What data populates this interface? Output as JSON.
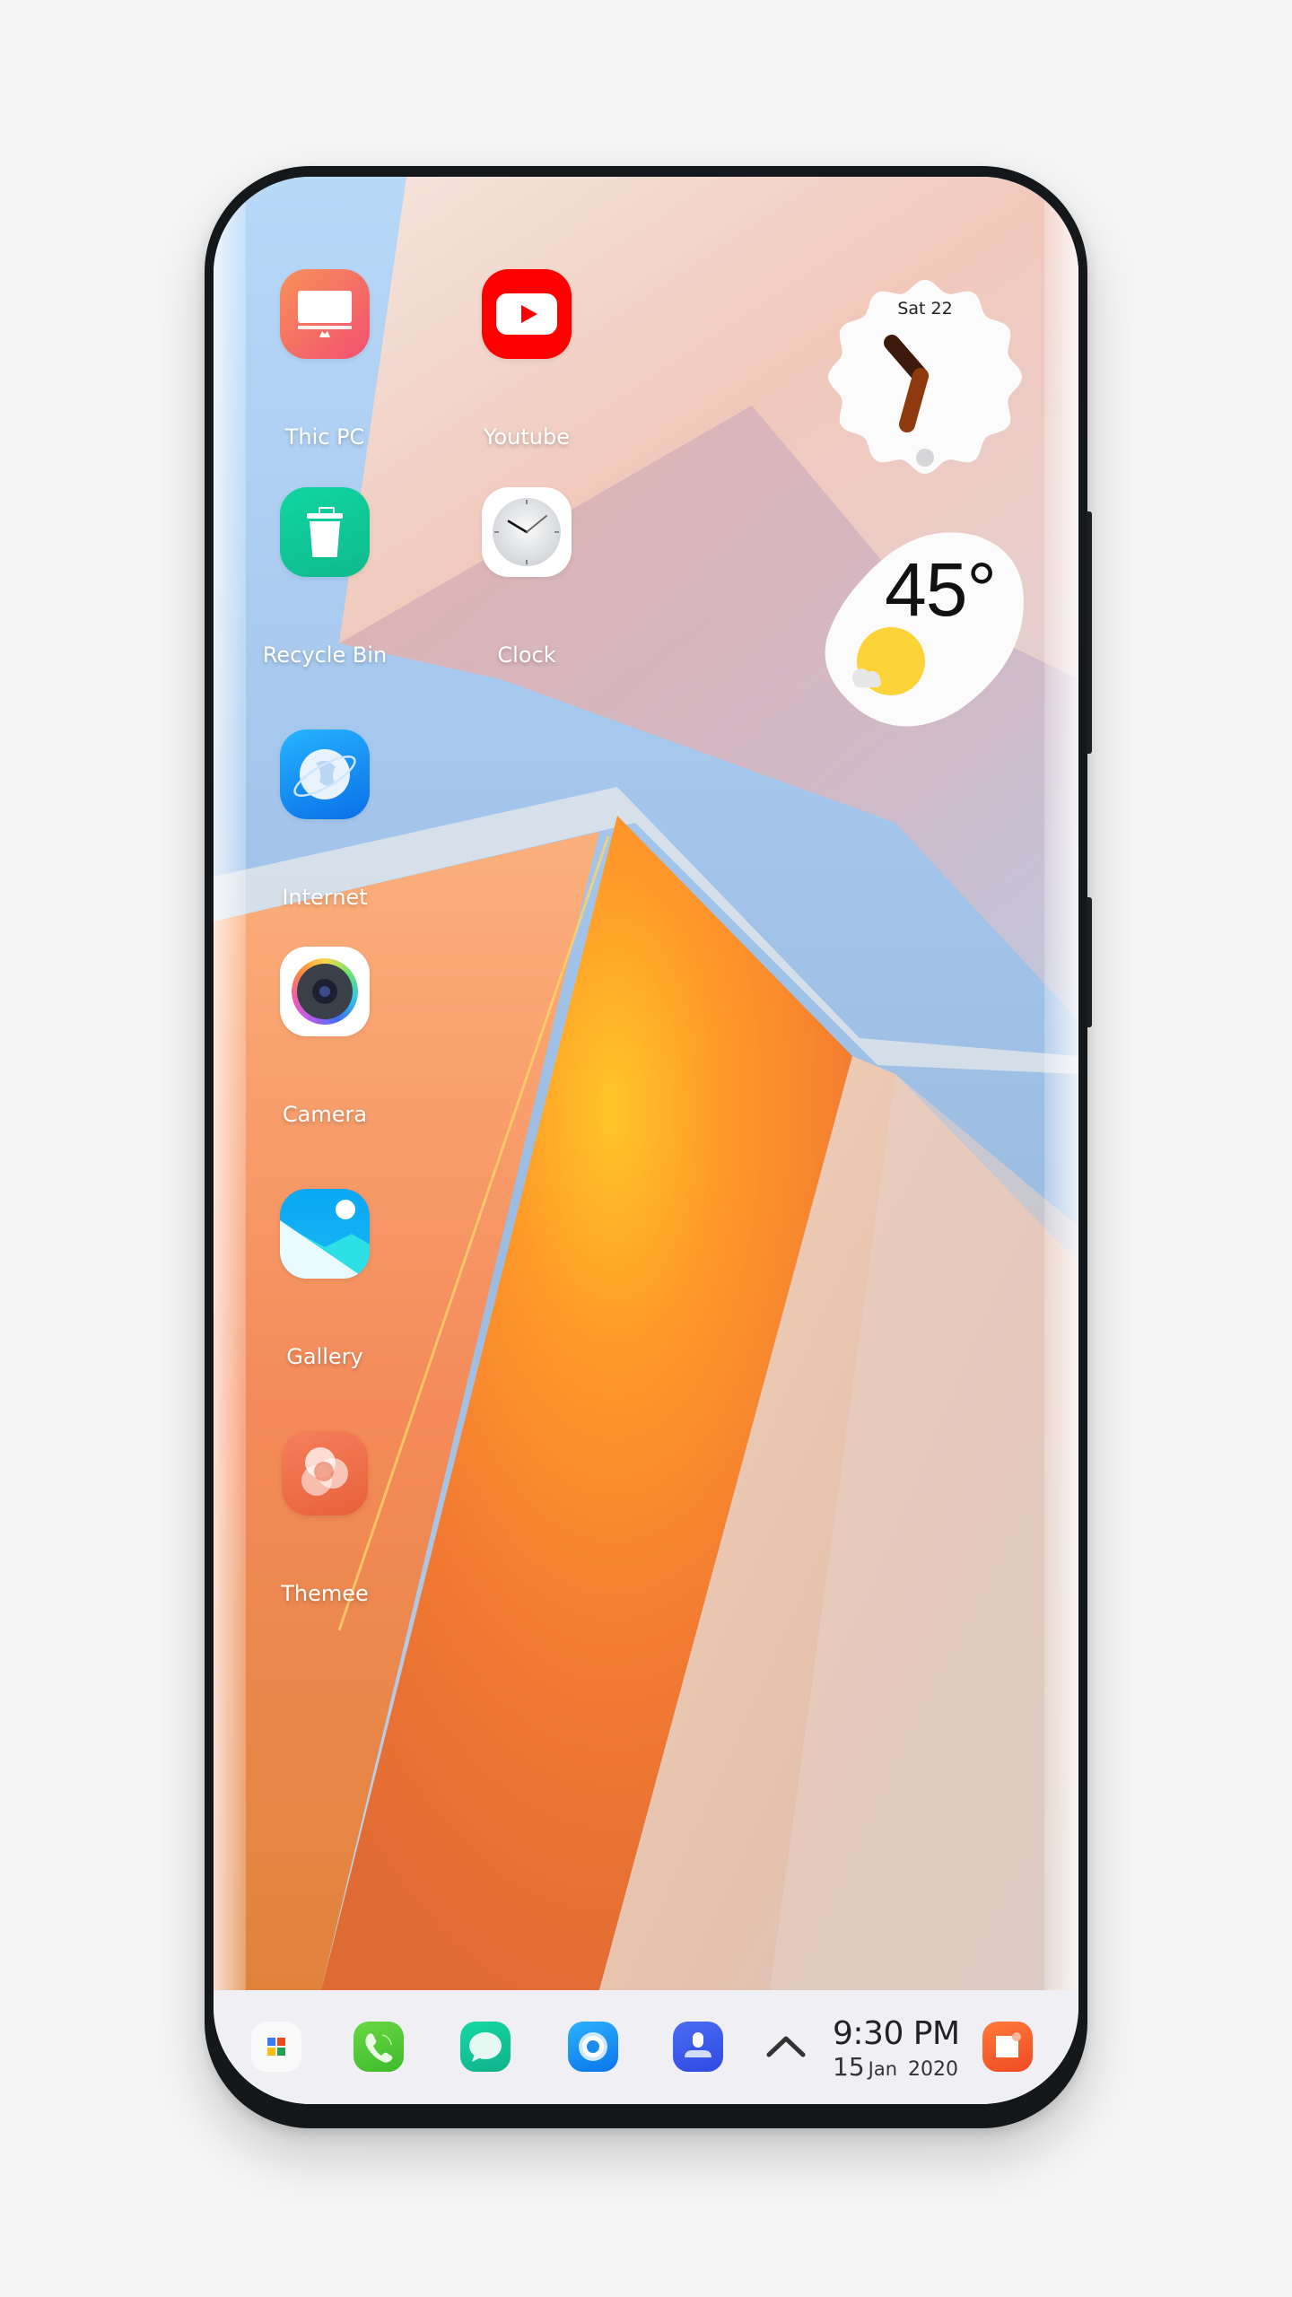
{
  "device": {
    "type": "phone",
    "screen": "home-screen"
  },
  "apps": [
    {
      "id": "this-pc",
      "label": "Thic PC",
      "icon": "monitor-icon",
      "color": "#f2656f"
    },
    {
      "id": "youtube",
      "label": "Youtube",
      "icon": "youtube-play-icon",
      "color": "#ff0000"
    },
    {
      "id": "recycle-bin",
      "label": "Recycle Bin",
      "icon": "trash-icon",
      "color": "#12c495"
    },
    {
      "id": "clock",
      "label": "Clock",
      "icon": "analog-clock-icon",
      "color": "#ffffff"
    },
    {
      "id": "internet",
      "label": "Internet",
      "icon": "globe-icon",
      "color": "#1a8cf0"
    },
    {
      "id": "camera",
      "label": "Camera",
      "icon": "camera-lens-icon",
      "color": "#ffffff"
    },
    {
      "id": "gallery",
      "label": "Gallery",
      "icon": "gallery-mountain-icon",
      "color": "#1ab0f5"
    },
    {
      "id": "themee",
      "label": "Themee",
      "icon": "swirl-icon",
      "color": "#ef6b45"
    }
  ],
  "widgets": {
    "clock": {
      "date": "Sat 22",
      "hour_hand_color": "#3e1a0c",
      "minute_hand_color": "#8f3a0e"
    },
    "weather": {
      "temperature": "45°",
      "condition": "sunny-with-cloud",
      "sun_color": "#fcd43a"
    }
  },
  "dock": {
    "items": [
      {
        "id": "app-drawer",
        "icon": "app-grid-icon"
      },
      {
        "id": "phone",
        "icon": "phone-icon",
        "color": "#4fc838"
      },
      {
        "id": "messages",
        "icon": "message-bubble-icon",
        "color": "#12c49a"
      },
      {
        "id": "browser",
        "icon": "ring-browser-icon",
        "color": "#1a8cf0"
      },
      {
        "id": "contacts",
        "icon": "contact-person-icon",
        "color": "#3f5ef0"
      }
    ],
    "expand_icon": "chevron-up-icon",
    "time": "9:30 PM",
    "date_day": "15",
    "date_month": "Jan",
    "date_year": "2020",
    "notes": {
      "id": "notes",
      "icon": "notes-icon",
      "color": "#f05a2c"
    }
  }
}
